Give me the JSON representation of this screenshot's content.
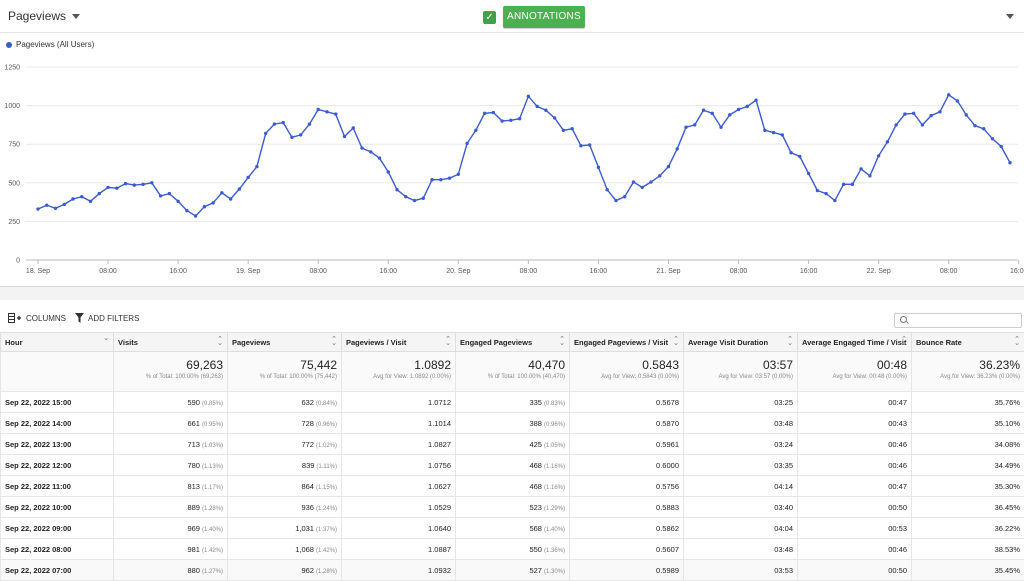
{
  "topbar": {
    "metric_label": "Pageviews",
    "annotations_label": "ANNOTATIONS",
    "check_glyph": "✓"
  },
  "colors": {
    "series": "#3c5bce",
    "accent": "#4caf50"
  },
  "chart_data": {
    "type": "line",
    "legend": "Pageviews (All Users)",
    "ylim": [
      0,
      1250
    ],
    "yticks": [
      0,
      250,
      500,
      750,
      1000,
      1250
    ],
    "xtick_labels": [
      "18. Sep",
      "08:00",
      "16:00",
      "19. Sep",
      "08:00",
      "16:00",
      "20. Sep",
      "08:00",
      "16:00",
      "21. Sep",
      "08:00",
      "16:00",
      "22. Sep",
      "08:00",
      "16:00"
    ],
    "grid": true,
    "series": [
      {
        "values": [
          330,
          355,
          335,
          360,
          395,
          410,
          380,
          430,
          470,
          465,
          495,
          485,
          490,
          500,
          415,
          430,
          380,
          320,
          285,
          345,
          370,
          435,
          395,
          460,
          535,
          605,
          820,
          880,
          890,
          795,
          810,
          880,
          975,
          960,
          945,
          800,
          855,
          725,
          700,
          660,
          570,
          455,
          410,
          385,
          400,
          520,
          520,
          530,
          555,
          755,
          840,
          950,
          955,
          900,
          905,
          915,
          1060,
          995,
          970,
          920,
          840,
          850,
          740,
          745,
          600,
          455,
          385,
          410,
          505,
          470,
          505,
          545,
          605,
          720,
          860,
          875,
          970,
          950,
          860,
          940,
          975,
          995,
          1035,
          840,
          825,
          810,
          695,
          670,
          560,
          450,
          430,
          385,
          490,
          490,
          590,
          545,
          675,
          765,
          875,
          945,
          950,
          875,
          935,
          960,
          1070,
          1030,
          940,
          870,
          850,
          785,
          735,
          630
        ]
      }
    ]
  },
  "toolbar": {
    "columns_label": "COLUMNS",
    "filters_label": "ADD FILTERS"
  },
  "table": {
    "headers": [
      "Hour",
      "Visits",
      "Pageviews",
      "Pageviews / Visit",
      "Engaged Pageviews",
      "Engaged Pageviews / Visit",
      "Average Visit Duration",
      "Average Engaged Time / Visit",
      "Bounce Rate"
    ],
    "totals": [
      {
        "value": "",
        "sub": ""
      },
      {
        "value": "69,263",
        "sub": "% of Total: 100.00% (69,263)"
      },
      {
        "value": "75,442",
        "sub": "% of Total: 100.00% (75,442)"
      },
      {
        "value": "1.0892",
        "sub": "Avg for View: 1.0892 (0.00%)"
      },
      {
        "value": "40,470",
        "sub": "% of Total: 100.00% (40,470)"
      },
      {
        "value": "0.5843",
        "sub": "Avg for View: 0.5843 (0.00%)"
      },
      {
        "value": "03:57",
        "sub": "Avg for View: 03:57 (0.00%)"
      },
      {
        "value": "00:48",
        "sub": "Avg for View: 00:48 (0.00%)"
      },
      {
        "value": "36.23%",
        "sub": "Avg for View: 36.23% (0.00%)"
      }
    ],
    "rows": [
      [
        "Sep 22, 2022 15:00",
        "590",
        "(0.85%)",
        "632",
        "(0.84%)",
        "1.0712",
        "335",
        "(0.83%)",
        "0.5678",
        "03:25",
        "00:47",
        "35.76%"
      ],
      [
        "Sep 22, 2022 14:00",
        "661",
        "(0.95%)",
        "728",
        "(0.96%)",
        "1.1014",
        "388",
        "(0.96%)",
        "0.5870",
        "03:48",
        "00:43",
        "35.10%"
      ],
      [
        "Sep 22, 2022 13:00",
        "713",
        "(1.03%)",
        "772",
        "(1.02%)",
        "1.0827",
        "425",
        "(1.05%)",
        "0.5961",
        "03:24",
        "00:46",
        "34.08%"
      ],
      [
        "Sep 22, 2022 12:00",
        "780",
        "(1.13%)",
        "839",
        "(1.11%)",
        "1.0756",
        "468",
        "(1.16%)",
        "0.6000",
        "03:35",
        "00:46",
        "34.49%"
      ],
      [
        "Sep 22, 2022 11:00",
        "813",
        "(1.17%)",
        "864",
        "(1.15%)",
        "1.0627",
        "468",
        "(1.16%)",
        "0.5756",
        "04:14",
        "00:47",
        "35.30%"
      ],
      [
        "Sep 22, 2022 10:00",
        "889",
        "(1.28%)",
        "936",
        "(1.24%)",
        "1.0529",
        "523",
        "(1.29%)",
        "0.5883",
        "03:40",
        "00:50",
        "36.45%"
      ],
      [
        "Sep 22, 2022 09:00",
        "969",
        "(1.40%)",
        "1,031",
        "(1.37%)",
        "1.0640",
        "568",
        "(1.40%)",
        "0.5862",
        "04:04",
        "00:53",
        "36.22%"
      ],
      [
        "Sep 22, 2022 08:00",
        "981",
        "(1.42%)",
        "1,068",
        "(1.42%)",
        "1.0887",
        "550",
        "(1.36%)",
        "0.5607",
        "03:48",
        "00:46",
        "38.53%"
      ],
      [
        "Sep 22, 2022 07:00",
        "880",
        "(1.27%)",
        "962",
        "(1.28%)",
        "1.0932",
        "527",
        "(1.30%)",
        "0.5989",
        "03:53",
        "00:50",
        "35.45%"
      ]
    ]
  }
}
